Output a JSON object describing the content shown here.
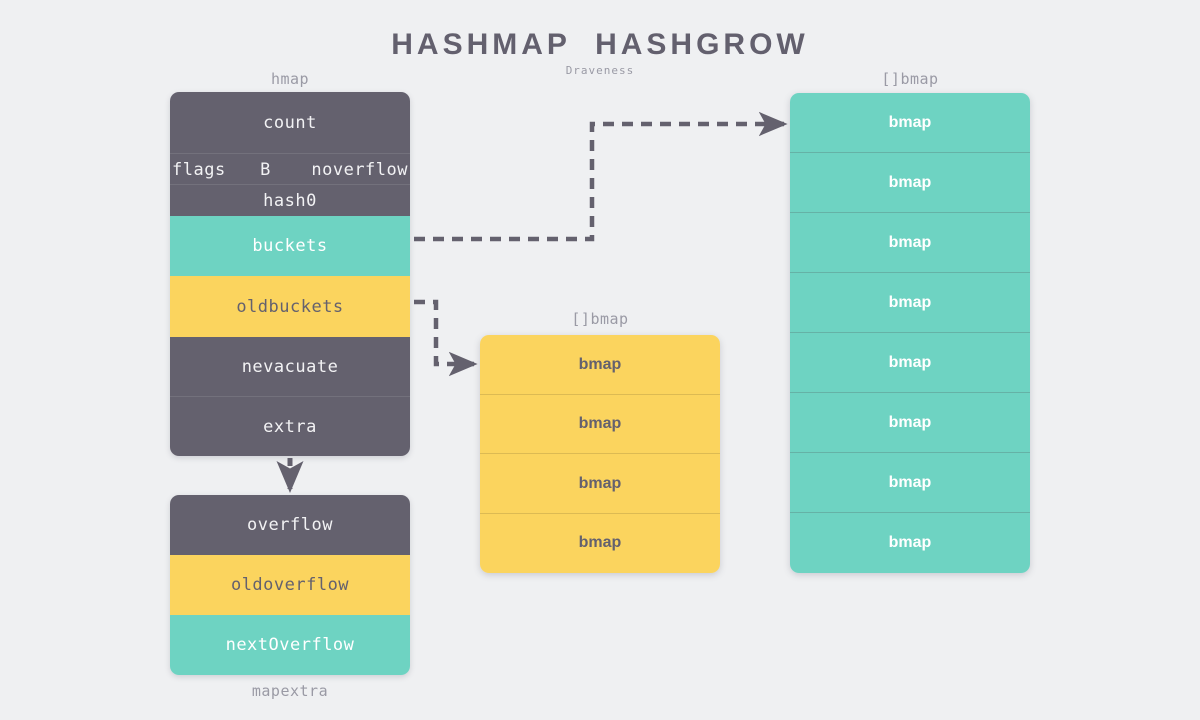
{
  "header": {
    "title": "HASHMAP  HASHGROW",
    "subtitle": "Draveness"
  },
  "colors": {
    "background": "#eff0f2",
    "dark": "#64616e",
    "teal": "#6ed3c2",
    "amber": "#fbd45e",
    "caption": "#9a9aa5",
    "arrow": "#64616e"
  },
  "hmap": {
    "caption": "hmap",
    "rows": [
      {
        "label": "count",
        "color": "dark"
      },
      {
        "label": "flags B noverflow",
        "color": "dark",
        "parts": [
          "flags",
          "B",
          "noverflow"
        ]
      },
      {
        "label": "hash0",
        "color": "dark"
      },
      {
        "label": "buckets",
        "color": "teal"
      },
      {
        "label": "oldbuckets",
        "color": "amber"
      },
      {
        "label": "nevacuate",
        "color": "dark"
      },
      {
        "label": "extra",
        "color": "dark"
      }
    ]
  },
  "mapextra": {
    "caption": "mapextra",
    "rows": [
      {
        "label": "overflow",
        "color": "dark"
      },
      {
        "label": "oldoverflow",
        "color": "amber"
      },
      {
        "label": "nextOverflow",
        "color": "teal"
      }
    ]
  },
  "old_bmap_array": {
    "caption": "[]bmap",
    "color": "amber",
    "cells": [
      "bmap",
      "bmap",
      "bmap",
      "bmap"
    ]
  },
  "new_bmap_array": {
    "caption": "[]bmap",
    "color": "teal",
    "cells": [
      "bmap",
      "bmap",
      "bmap",
      "bmap",
      "bmap",
      "bmap",
      "bmap",
      "bmap"
    ]
  },
  "edges": [
    {
      "from": "buckets",
      "to": "new_bmap_array",
      "style": "dashed-arrow"
    },
    {
      "from": "oldbuckets",
      "to": "old_bmap_array",
      "style": "dashed-arrow"
    },
    {
      "from": "extra",
      "to": "mapextra",
      "style": "dashed-arrow"
    }
  ]
}
